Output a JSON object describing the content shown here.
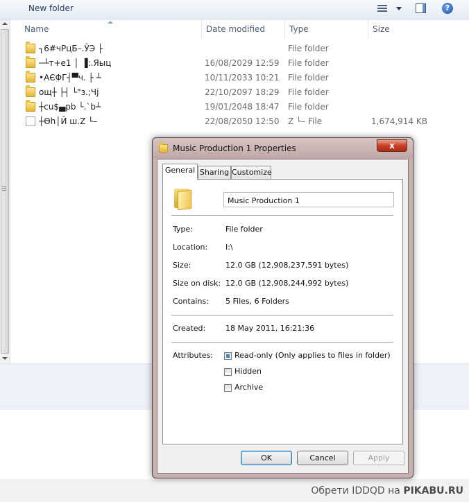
{
  "toolbar": {
    "new_folder_label": "New folder"
  },
  "columns": {
    "name": "Name",
    "date_modified": "Date modified",
    "type": "Type",
    "size": "Size"
  },
  "files": [
    {
      "name": "┐6#чРцБ–.ЎЭ ├",
      "date": "",
      "type": "File folder",
      "size": "",
      "kind": "folder"
    },
    {
      "name": "─┴т+е1 │ ▐:.Яыц",
      "date": "16/08/2029 12:59",
      "type": "File folder",
      "size": "",
      "kind": "folder"
    },
    {
      "name": "•AЄΦГ┤▀ч. ├ ┴",
      "date": "10/11/2033 10:21",
      "type": "File folder",
      "size": "",
      "kind": "folder"
    },
    {
      "name": "ощ┼ ├┤ └\"з.;Чj",
      "date": "22/10/2097 18:29",
      "type": "File folder",
      "size": "",
      "kind": "folder"
    },
    {
      "name": "┼cu$▄pb └.`b┴",
      "date": "19/01/2048 18:47",
      "type": "File folder",
      "size": "",
      "kind": "folder"
    },
    {
      "name": "┼Ѳh│Й ш.Z └–",
      "date": "22/08/2050 12:50",
      "type": "Z └– File",
      "size": "1,674,914 KB",
      "kind": "file"
    }
  ],
  "dialog": {
    "title": "Music Production 1 Properties",
    "close_label": "x",
    "tabs": {
      "general": "General",
      "sharing": "Sharing",
      "customize": "Customize"
    },
    "folder_name": "Music Production 1",
    "props": {
      "type_label": "Type:",
      "type_value": "File folder",
      "location_label": "Location:",
      "location_value": "I:\\",
      "size_label": "Size:",
      "size_value": "12.0 GB (12,908,237,591 bytes)",
      "size_on_disk_label": "Size on disk:",
      "size_on_disk_value": "12.0 GB (12,908,244,992 bytes)",
      "contains_label": "Contains:",
      "contains_value": "5 Files, 6 Folders",
      "created_label": "Created:",
      "created_value": "18 May 2011, 16:21:36",
      "attributes_label": "Attributes:"
    },
    "attributes": {
      "read_only": "Read-only (Only applies to files in folder)",
      "hidden": "Hidden",
      "archive": "Archive"
    },
    "buttons": {
      "ok": "OK",
      "cancel": "Cancel",
      "apply": "Apply"
    }
  },
  "watermark": {
    "text": "Обрети IDDQD на",
    "site": "PIKABU.RU"
  }
}
